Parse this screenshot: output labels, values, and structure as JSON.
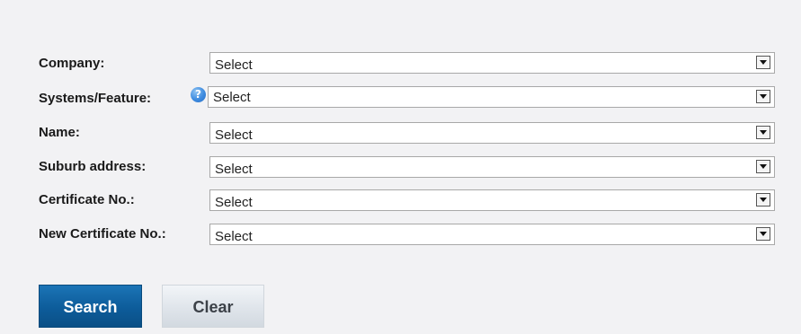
{
  "form": {
    "fields": [
      {
        "label": "Company:",
        "value": "Select"
      },
      {
        "label": "Systems/Feature:",
        "value": "Select",
        "help_icon": "help-question-icon"
      },
      {
        "label": "Name:",
        "value": "Select"
      },
      {
        "label": "Suburb address:",
        "value": "Select"
      },
      {
        "label": "Certificate No.:",
        "value": "Select"
      },
      {
        "label": "New Certificate No.:",
        "value": "Select"
      }
    ],
    "help_glyph": "?"
  },
  "buttons": {
    "search_label": "Search",
    "clear_label": "Clear"
  },
  "colors": {
    "background": "#f2f2f4",
    "search_button": "#0d5c9a",
    "clear_button": "#e1e6ec",
    "help_icon": "#3d8be0"
  }
}
